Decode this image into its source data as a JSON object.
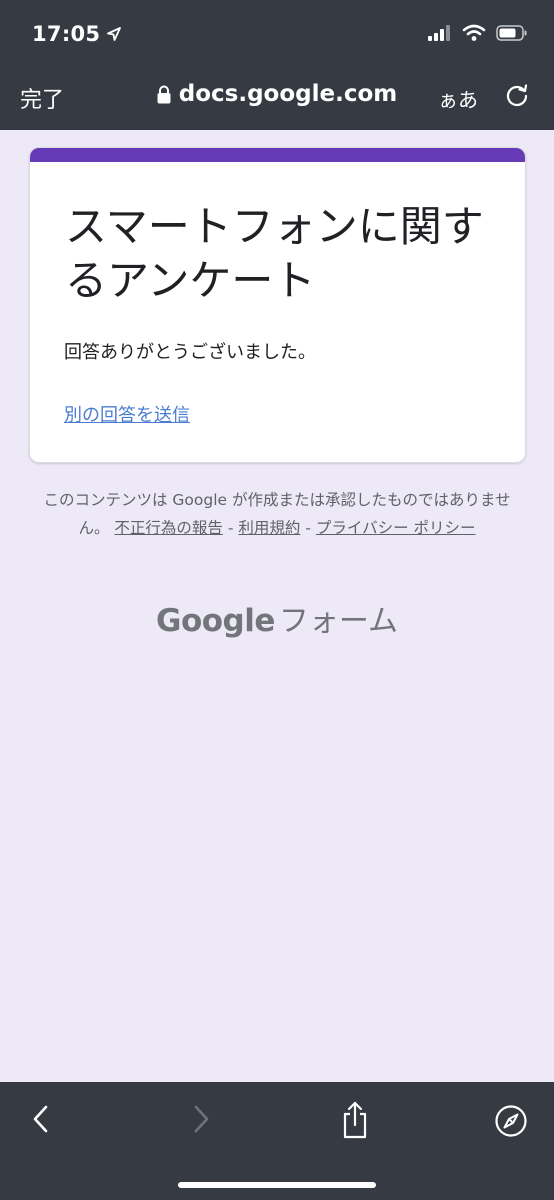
{
  "status_bar": {
    "time": "17:05",
    "icons": [
      "location-arrow-icon",
      "signal-icon",
      "wifi-icon",
      "battery-icon"
    ]
  },
  "browser": {
    "done_label": "完了",
    "url": "docs.google.com",
    "text_size_label": "ぁあ",
    "icons": {
      "lock": "lock-icon",
      "reload": "reload-icon",
      "back": "chevron-left-icon",
      "forward": "chevron-right-icon",
      "share": "share-icon",
      "compass": "compass-icon"
    }
  },
  "form": {
    "title": "スマートフォンに関するアンケート",
    "message": "回答ありがとうございました。",
    "submit_another_label": "別の回答を送信"
  },
  "footer": {
    "disclaimer": "このコンテンツは Google が作成または承認したものではありません。",
    "report_abuse_label": "不正行為の報告",
    "terms_label": "利用規約",
    "privacy_label": "プライバシー ポリシー",
    "separator": "-",
    "brand_google": "Google",
    "brand_forms": "フォーム"
  },
  "colors": {
    "accent": "#673ab7",
    "page_background": "#ede9f6",
    "chrome": "#363b43",
    "link": "#4a7dd1"
  }
}
